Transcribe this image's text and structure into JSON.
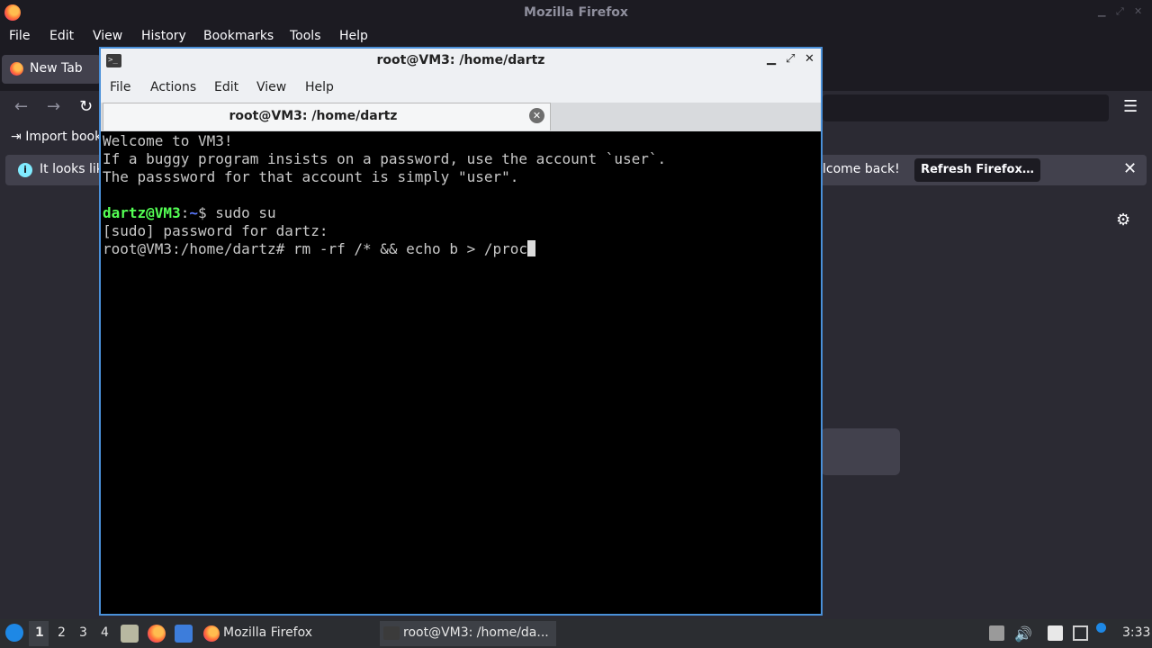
{
  "firefox": {
    "window_title": "Mozilla Firefox",
    "menu": [
      "File",
      "Edit",
      "View",
      "History",
      "Bookmarks",
      "Tools",
      "Help"
    ],
    "tab_label": "New Tab",
    "bookmarks_item": "Import book",
    "notification": {
      "text_left": "It looks lik",
      "text_right": "lcome back!",
      "refresh_button": "Refresh Firefox…"
    }
  },
  "terminal": {
    "window_title": "root@VM3: /home/dartz",
    "menu": [
      "File",
      "Actions",
      "Edit",
      "View",
      "Help"
    ],
    "tab_label": "root@VM3: /home/dartz",
    "lines": [
      "Welcome to VM3!",
      "If a buggy program insists on a password, use the account `user`.",
      "The passsword for that account is simply \"user\".",
      ""
    ],
    "prompt": {
      "user_host": "dartz@VM3",
      "colon": ":",
      "path": "~",
      "symbol": "$ ",
      "command": "sudo su"
    },
    "sudo_line": "[sudo] password for dartz:",
    "root_line": "root@VM3:/home/dartz# rm -rf /* && echo b > /proc"
  },
  "taskbar": {
    "workspaces": [
      "1",
      "2",
      "3",
      "4"
    ],
    "tasks": [
      {
        "label": "Mozilla Firefox"
      },
      {
        "label": "root@VM3: /home/da..."
      }
    ],
    "clock": "3:33"
  },
  "colors": {
    "prompt_green": "#54ff54",
    "prompt_blue": "#5b79ff",
    "terminal_border": "#4a90d9"
  }
}
